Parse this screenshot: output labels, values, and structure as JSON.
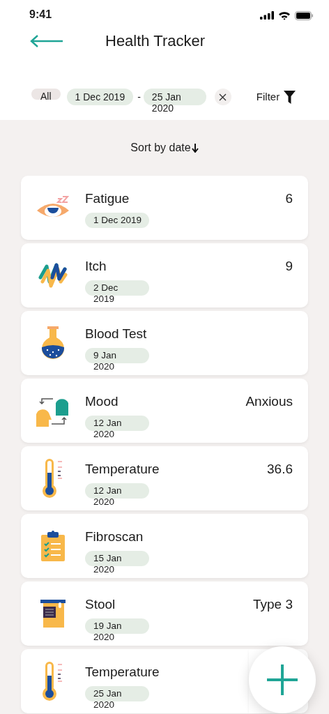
{
  "status_bar": {
    "time": "9:41"
  },
  "header": {
    "title": "Health Tracker"
  },
  "filters": {
    "all_label": "All",
    "from": "1 Dec 2019",
    "separator": "-",
    "to": "25 Jan\n2020",
    "filter_label": "Filter"
  },
  "sort": {
    "label": "Sort by date"
  },
  "entries": [
    {
      "kind": "eye",
      "name": "Fatigue",
      "date": "1 Dec 2019",
      "value": "6"
    },
    {
      "kind": "squiggle",
      "name": "Itch",
      "date": "2 Dec\n2019",
      "value": "9"
    },
    {
      "kind": "flask",
      "name": "Blood Test",
      "date": "9 Jan\n2020"
    },
    {
      "kind": "heads",
      "name": "Mood",
      "date": "12 Jan\n2020",
      "value": "Anxious"
    },
    {
      "kind": "thermometer",
      "name": "Temperature",
      "date": "12 Jan\n2020",
      "value": "36.6"
    },
    {
      "kind": "clipboard",
      "name": "Fibroscan",
      "date": "15 Jan\n2020"
    },
    {
      "kind": "sample",
      "name": "Stool",
      "date": "19 Jan\n2020",
      "value": "Type 3"
    },
    {
      "kind": "thermometer",
      "name": "Temperature",
      "date": "25 Jan\n2020"
    }
  ]
}
